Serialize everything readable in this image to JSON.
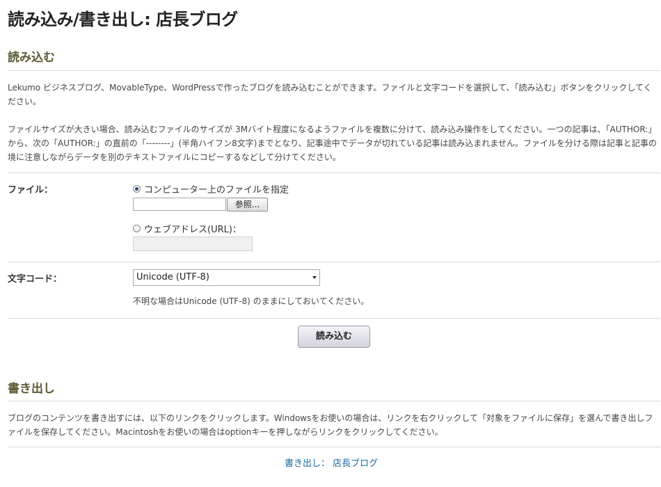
{
  "page": {
    "title": "読み込み/書き出し: 店長ブログ"
  },
  "import": {
    "heading": "読み込む",
    "intro": "Lekumo ビジネスブログ、MovableType、WordPressで作ったブログを読み込むことができます。ファイルと文字コードを選択して、「読み込む」ボタンをクリックしてください。",
    "note": "ファイルサイズが大きい場合、読み込むファイルのサイズが 3Mバイト程度になるようファイルを複数に分けて、読み込み操作をしてください。一つの記事は、「AUTHOR:」から、次の「AUTHOR:」の直前の「--------」(半角ハイフン8文字)までとなり、記事途中でデータが切れている記事は読み込まれません。ファイルを分ける際は記事と記事の境に注意しながらデータを別のテキストファイルにコピーするなどして分けてください。",
    "file_label": "ファイル：",
    "option_local": "コンピューター上のファイルを指定",
    "local_file_value": "",
    "browse_label": "参照...",
    "option_url": "ウェブアドレス(URL)：",
    "url_value": "",
    "encoding_label": "文字コード：",
    "encoding_selected": "Unicode (UTF-8)",
    "encoding_hint": "不明な場合はUnicode (UTF-8) のままにしておいてください。",
    "submit_label": "読み込む"
  },
  "export": {
    "heading": "書き出し",
    "description": "ブログのコンテンツを書き出すには、以下のリンクをクリックします。Windowsをお使いの場合は、リンクを右クリックして「対象をファイルに保存」を選んで書き出しファイルを保存してください。Macintoshをお使いの場合はoptionキーを押しながらリンクをクリックしてください。",
    "link_label": "書き出し： 店長ブログ"
  }
}
